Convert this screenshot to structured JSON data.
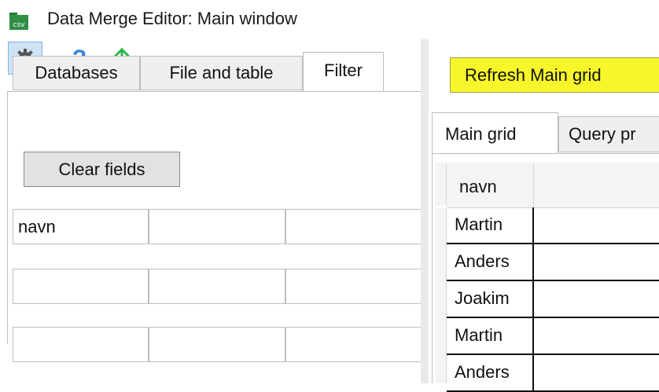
{
  "window": {
    "title": "Data Merge Editor: Main window",
    "icon_label": "csv"
  },
  "toolbar": {
    "help_glyph": "?",
    "icons": [
      "gear-icon",
      "help-icon",
      "upload-icon"
    ]
  },
  "left_tabs": [
    {
      "label": "Databases",
      "active": false
    },
    {
      "label": "File and table",
      "active": false
    },
    {
      "label": "Filter",
      "active": true
    }
  ],
  "filter": {
    "clear_label": "Clear fields",
    "rows": [
      [
        "navn",
        "",
        ""
      ],
      [
        "",
        "",
        ""
      ],
      [
        "",
        "",
        ""
      ]
    ]
  },
  "right": {
    "refresh_label": "Refresh Main grid",
    "tabs": [
      {
        "label": "Main grid",
        "active": true
      },
      {
        "label": "Query pr",
        "active": false
      }
    ],
    "grid": {
      "columns": [
        "navn"
      ],
      "rows": [
        "Martin",
        "Anders",
        "Joakim",
        "Martin",
        "Anders"
      ]
    }
  },
  "colors": {
    "highlight": "#f6f62a",
    "accent_blue": "#3a84d6",
    "upload_green": "#2bb54a"
  }
}
